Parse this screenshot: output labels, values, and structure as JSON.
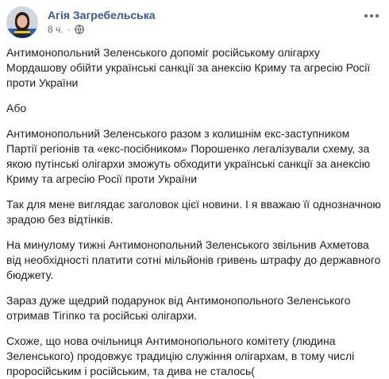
{
  "post": {
    "author": "Агія Загребельська",
    "time": "8 ч.",
    "meta_separator": "·",
    "privacy_icon": "globe-icon",
    "menu_icon": "more-horizontal-icon",
    "paragraphs": [
      "Антимонопольний Зеленського допоміг російському олігарху Мордашову обійти українські санкції за анексію Криму та агресію Росії проти України",
      "Або",
      "Антимонопольний Зеленського разом з колишнім екс-заступником Партії регіонів та «екс-посібником» Порошенко легалізували схему, за якою путінські олігархи зможуть обходити українські санкції за анексію Криму та агресію Росії проти України",
      "Так для мене виглядає заголовок цієї новини. І я вважаю її однозначною зрадою без відтінків.",
      "На минулому тижні Антимонопольний Зеленського звільнив Ахметова від необхідності платити сотні мільйонів гривень штрафу до державного бюджету.",
      "Зараз дуже щедрий подарунок від Антимонопольного Зеленського отримав Тігіпко та російські олігархи.",
      "Схоже, що нова очільниця Антимонопольного комітету (людина Зеленського) продовжує традицію служіння олігархам, в тому числі проросійським і російським, та дива не сталось("
    ]
  },
  "colors": {
    "author": "#385898",
    "meta": "#606770",
    "text": "#1c1e21"
  }
}
